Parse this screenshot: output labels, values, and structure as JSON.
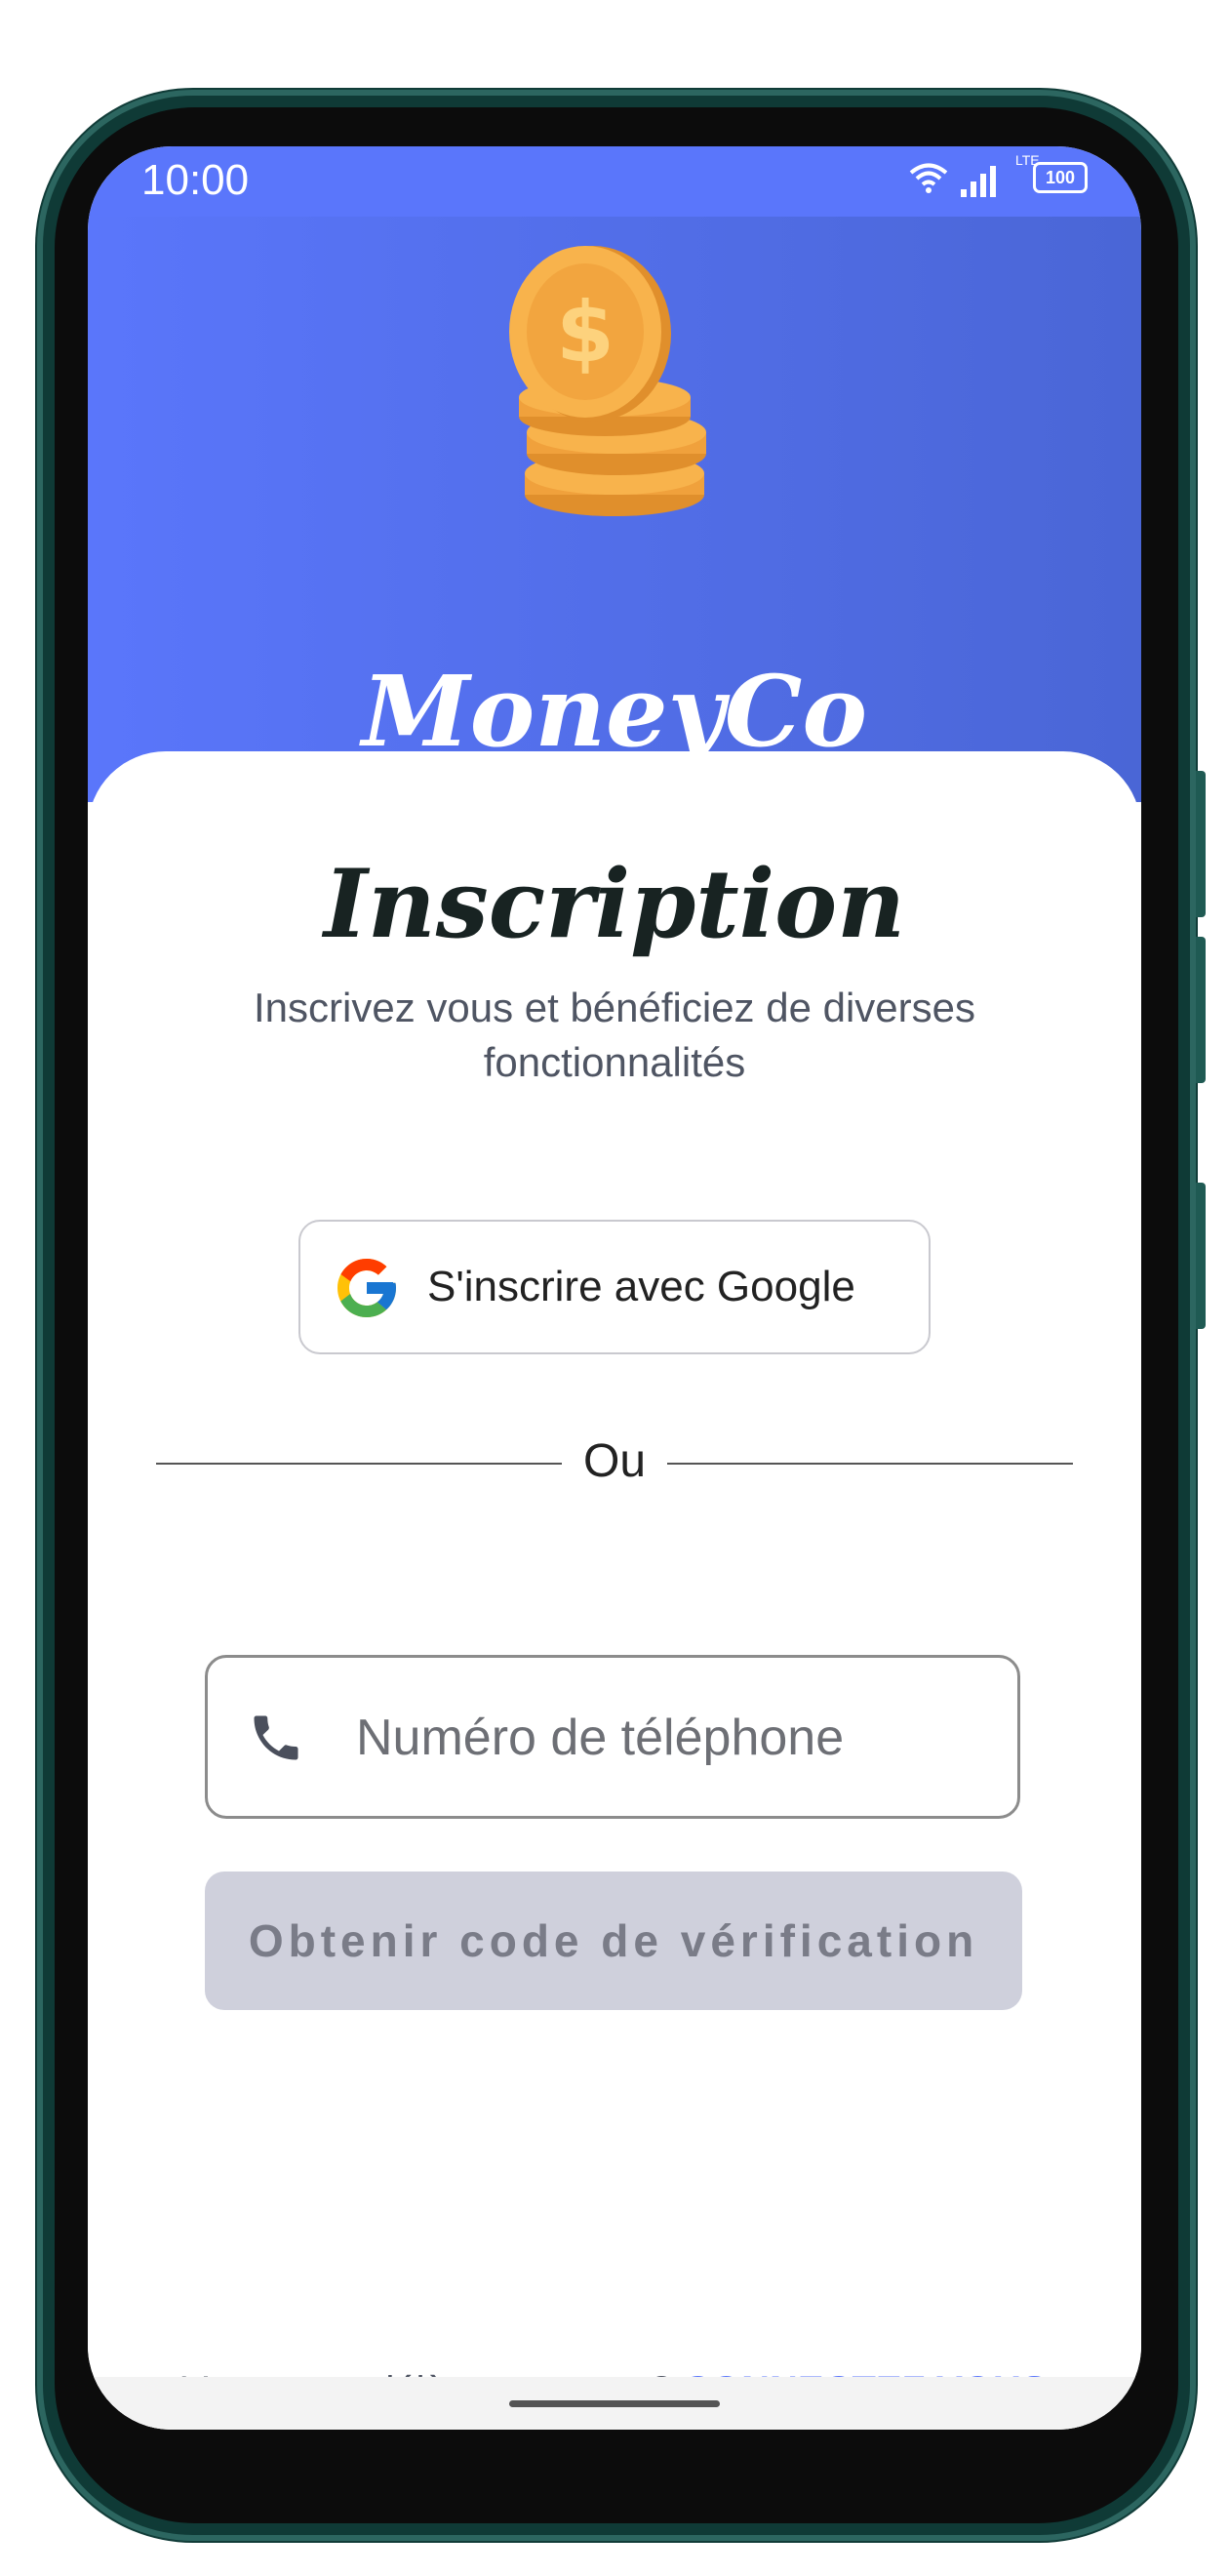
{
  "status_bar": {
    "time": "10:00",
    "network": "LTE",
    "battery": "100"
  },
  "brand": {
    "name": "MoneyCo",
    "logo_icon": "coin-stack-dollar-icon"
  },
  "signup": {
    "title": "Inscription",
    "subtitle": "Inscrivez vous et bénéficiez de diverses fonctionnalités",
    "google_button_label": "S'inscrire avec Google",
    "divider_label": "Ou",
    "phone_placeholder": "Numéro de téléphone",
    "verify_button_label": "Obtenir code de vérification",
    "has_account_text": "Vous avez déjà un compte ?",
    "login_link_label": "CONNECTEZ VOUS"
  },
  "colors": {
    "primary": "#5a76fb",
    "hero_gradient_end": "#4a66d6",
    "disabled_button_bg": "#cfd0dc",
    "disabled_button_text": "#7a7c88",
    "coin": "#f8b34c"
  }
}
